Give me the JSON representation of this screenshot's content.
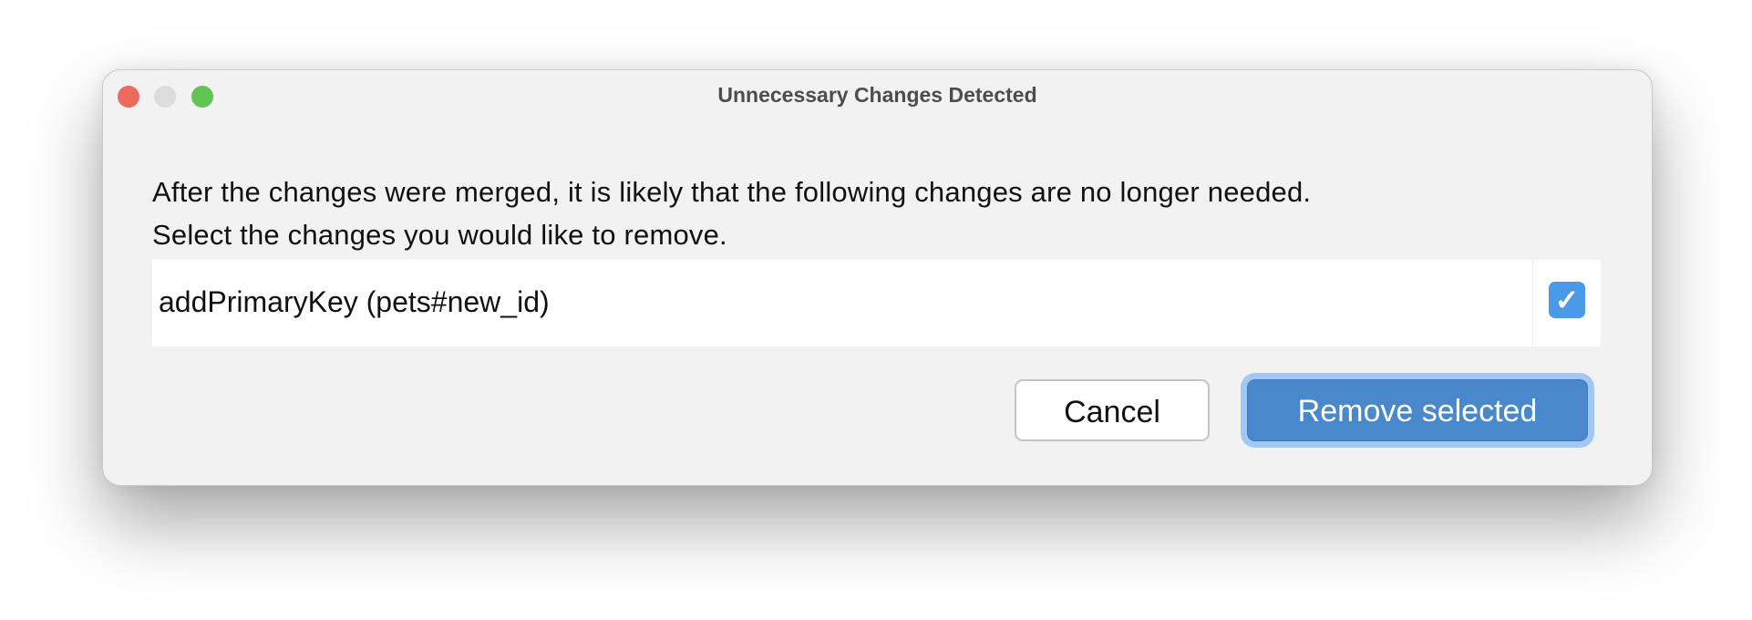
{
  "window": {
    "title": "Unnecessary Changes Detected"
  },
  "message": {
    "line1": "After the changes were merged, it is likely that the following changes are no longer needed.",
    "line2": "Select the changes you would like to remove."
  },
  "changes": [
    {
      "label": "addPrimaryKey (pets#new_id)",
      "checked": true
    }
  ],
  "buttons": {
    "cancel": "Cancel",
    "remove": "Remove selected"
  },
  "colors": {
    "close": "#ed6a5e",
    "minimize": "#dcdcdc",
    "zoom": "#61c554",
    "accent": "#4a88cc"
  }
}
